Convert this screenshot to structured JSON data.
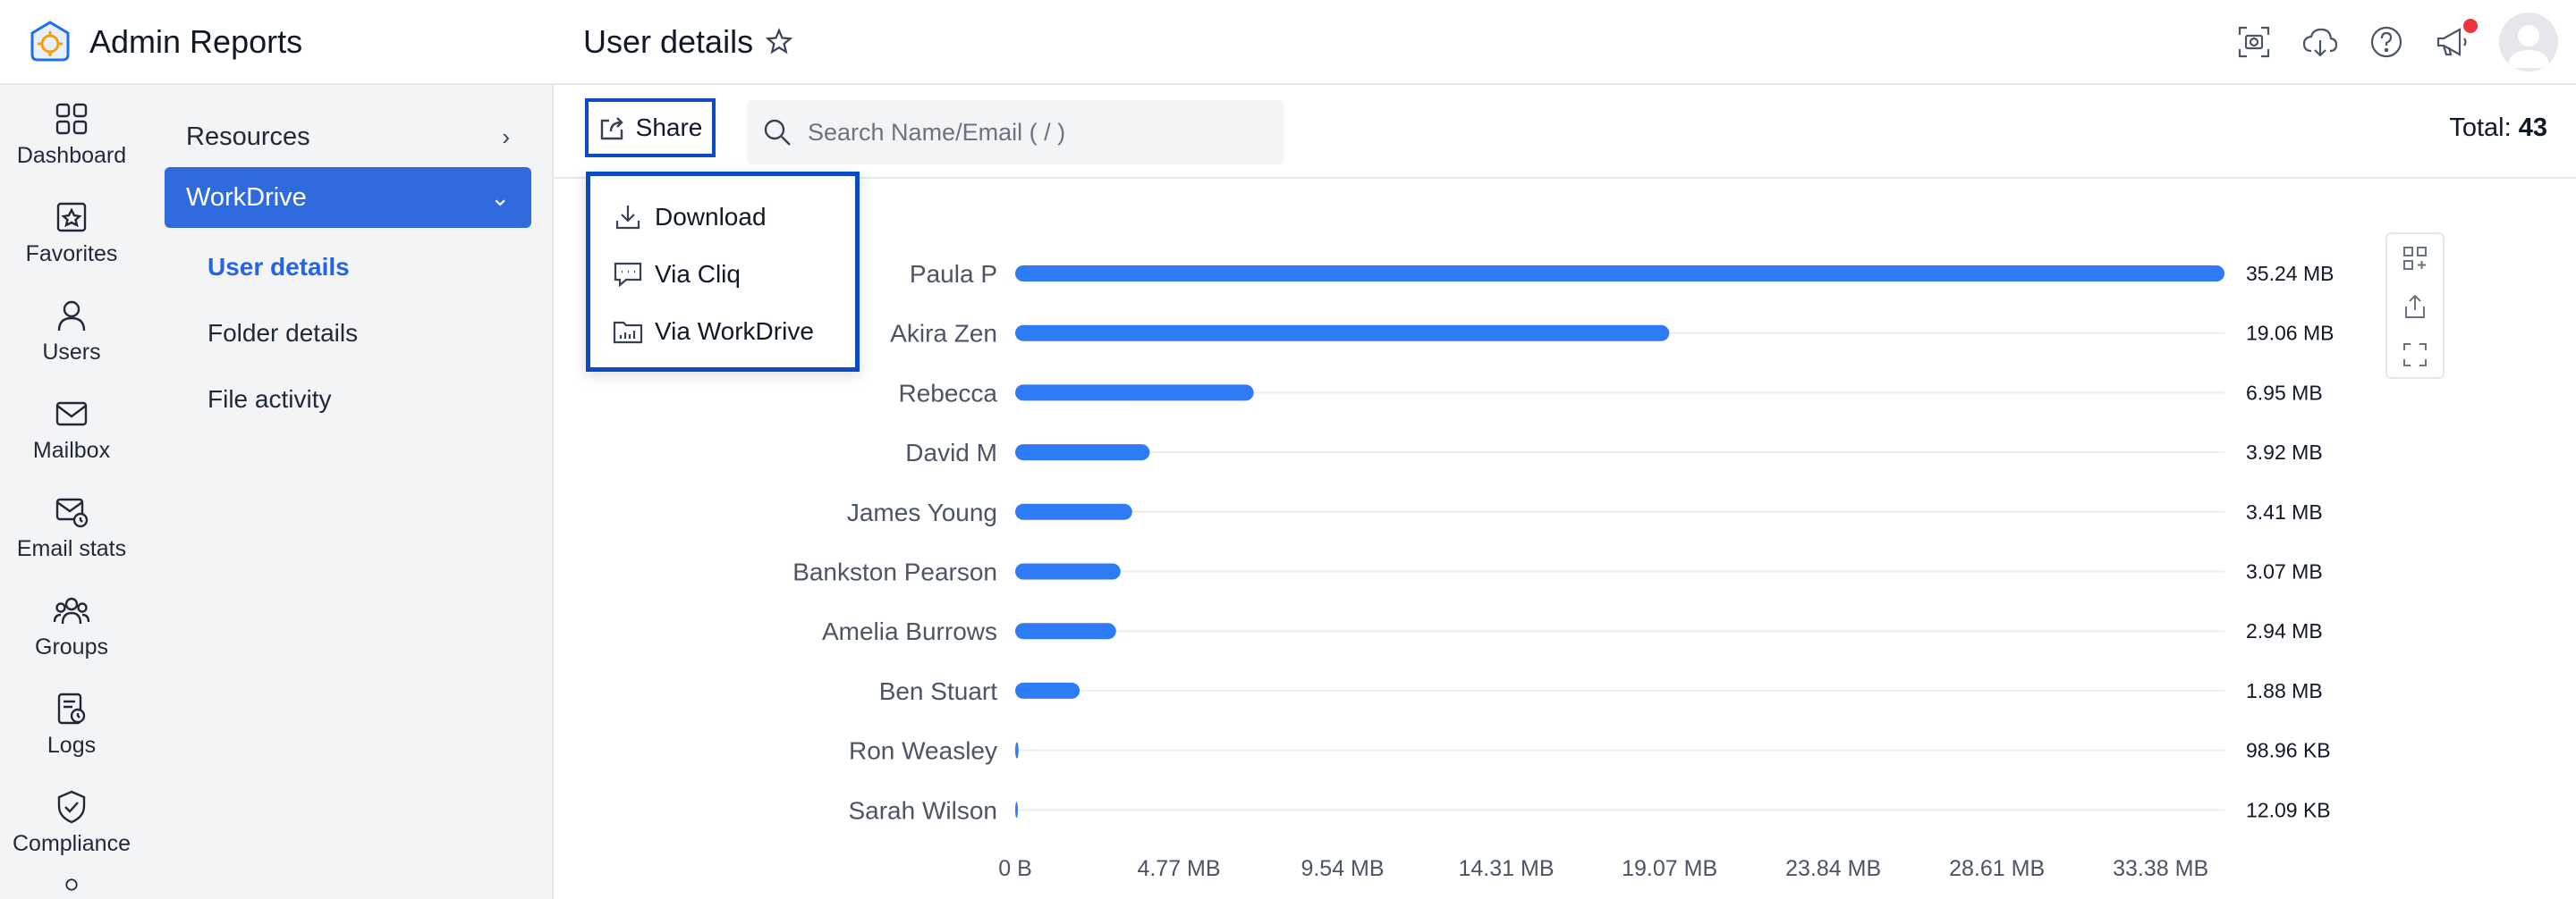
{
  "app": {
    "title": "Admin Reports"
  },
  "rail": [
    {
      "label": "Dashboard",
      "icon": "dashboard-icon"
    },
    {
      "label": "Favorites",
      "icon": "favorites-icon"
    },
    {
      "label": "Users",
      "icon": "users-icon"
    },
    {
      "label": "Mailbox",
      "icon": "mailbox-icon"
    },
    {
      "label": "Email stats",
      "icon": "email-stats-icon"
    },
    {
      "label": "Groups",
      "icon": "groups-icon"
    },
    {
      "label": "Logs",
      "icon": "logs-icon"
    },
    {
      "label": "Compliance",
      "icon": "compliance-icon"
    }
  ],
  "subnav": {
    "resources": "Resources",
    "workdrive": "WorkDrive",
    "items": [
      "User details",
      "Folder details",
      "File activity"
    ]
  },
  "header": {
    "title": "User details"
  },
  "toolbar": {
    "share_label": "Share",
    "search_placeholder": "Search Name/Email ( / )",
    "total_label": "Total:",
    "total_value": "43"
  },
  "share_menu": [
    "Download",
    "Via Cliq",
    "Via WorkDrive"
  ],
  "colors": {
    "accent": "#2f6bdc",
    "bar": "#2f7bf5",
    "highlight_border": "#0b4bc4",
    "notification": "#ef3340"
  },
  "chart_data": {
    "type": "bar",
    "orientation": "horizontal",
    "categories": [
      "Paula P",
      "Akira Zen",
      "Rebecca",
      "David M",
      "James Young",
      "Bankston Pearson",
      "Amelia Burrows",
      "Ben Stuart",
      "Ron Weasley",
      "Sarah Wilson"
    ],
    "values_mb": [
      35.24,
      19.06,
      6.95,
      3.92,
      3.41,
      3.07,
      2.94,
      1.88,
      0.0967,
      0.0118
    ],
    "data_labels": [
      "35.24 MB",
      "19.06 MB",
      "6.95 MB",
      "3.92 MB",
      "3.41 MB",
      "3.07 MB",
      "2.94 MB",
      "1.88 MB",
      "98.96 KB",
      "12.09 KB"
    ],
    "x_ticks": [
      "0 B",
      "4.77 MB",
      "9.54 MB",
      "14.31 MB",
      "19.07 MB",
      "23.84 MB",
      "28.61 MB",
      "33.38 MB"
    ],
    "x_tick_values": [
      0,
      4.77,
      9.54,
      14.31,
      19.07,
      23.84,
      28.61,
      33.38
    ],
    "xlim": [
      0,
      35.24
    ],
    "grid": true
  }
}
